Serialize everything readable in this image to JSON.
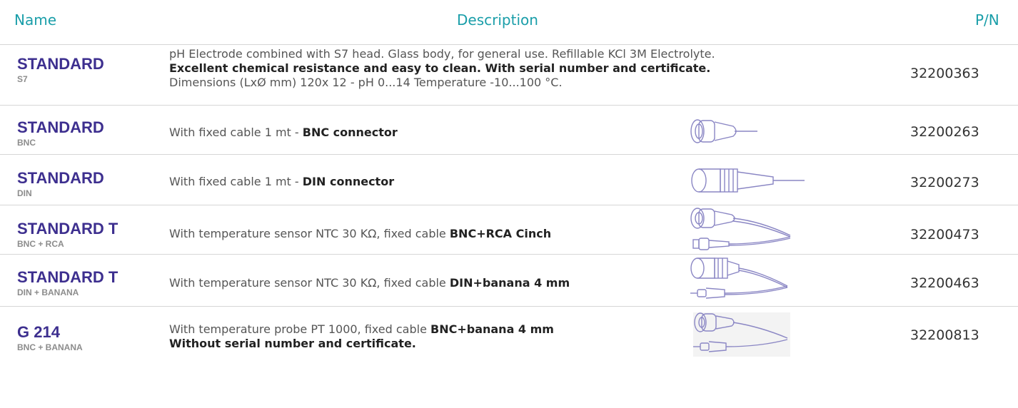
{
  "headers": {
    "name": "Name",
    "description": "Description",
    "pn": "P/N"
  },
  "rows": [
    {
      "name": "STANDARD",
      "sub": "S7",
      "line1_a": "pH Electrode combined with S7 head. Glass body, for general use. Refillable KCl 3M Electrolyte.",
      "line2_b": "Excellent chemical resistance and easy to clean. With serial number and certificate.",
      "line3_a": "Dimensions (LxØ mm) 120x 12 - pH 0...14 Temperature -10...100 °C.",
      "pn": "32200363",
      "image": ""
    },
    {
      "name": "STANDARD",
      "sub": "BNC",
      "desc_a": "With fixed cable 1 mt - ",
      "desc_b": "BNC connector",
      "pn": "32200263",
      "image": "bnc-connector-icon"
    },
    {
      "name": "STANDARD",
      "sub": "DIN",
      "desc_a": "With fixed cable 1 mt - ",
      "desc_b": "DIN connector",
      "pn": "32200273",
      "image": "din-connector-icon"
    },
    {
      "name": "STANDARD T",
      "sub": "BNC + RCA",
      "desc_a": "With temperature sensor NTC 30 KΩ, fixed cable ",
      "desc_b": "BNC+RCA Cinch",
      "pn": "32200473",
      "image": "bnc-rca-connector-icon"
    },
    {
      "name": "STANDARD T",
      "sub": "DIN + BANANA",
      "desc_a": "With temperature sensor NTC 30 KΩ, fixed cable  ",
      "desc_b": "DIN+banana 4 mm",
      "pn": "32200463",
      "image": "din-banana-connector-icon"
    },
    {
      "name": "G 214",
      "sub": "BNC + BANANA",
      "desc_a": "With temperature probe PT 1000, fixed cable ",
      "desc_b": "BNC+banana 4 mm",
      "line2_b": "Without serial number and certificate.",
      "pn": "32200813",
      "image": "bnc-banana-connector-icon"
    }
  ]
}
